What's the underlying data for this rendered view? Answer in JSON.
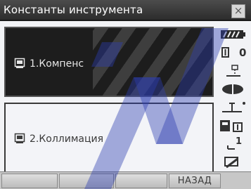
{
  "window": {
    "title": "Константы инструмента",
    "close_glyph": "×"
  },
  "menu": {
    "items": [
      {
        "label": "1.Компенс",
        "icon": "compensator-icon",
        "selected": true
      },
      {
        "label": "2.Коллимация",
        "icon": "collimation-icon",
        "selected": false
      }
    ]
  },
  "status_icons": [
    "battery-icon",
    "target-constant-icon",
    "laser-plummet-icon",
    "prism-icon",
    "tilt-correction-icon",
    "memory-card-icon",
    "input-mode-icon",
    "edit-icon"
  ],
  "status_text": {
    "target_constant": "0",
    "input_mode": "1"
  },
  "softkeys": [
    {
      "label": ""
    },
    {
      "label": ""
    },
    {
      "label": ""
    },
    {
      "label": "НАЗАД"
    }
  ],
  "colors": {
    "titlebar": "#3a3a3a",
    "selected_item": "#1d1d1d",
    "background": "#f2f3f6",
    "watermark": "#2e3fb0"
  }
}
